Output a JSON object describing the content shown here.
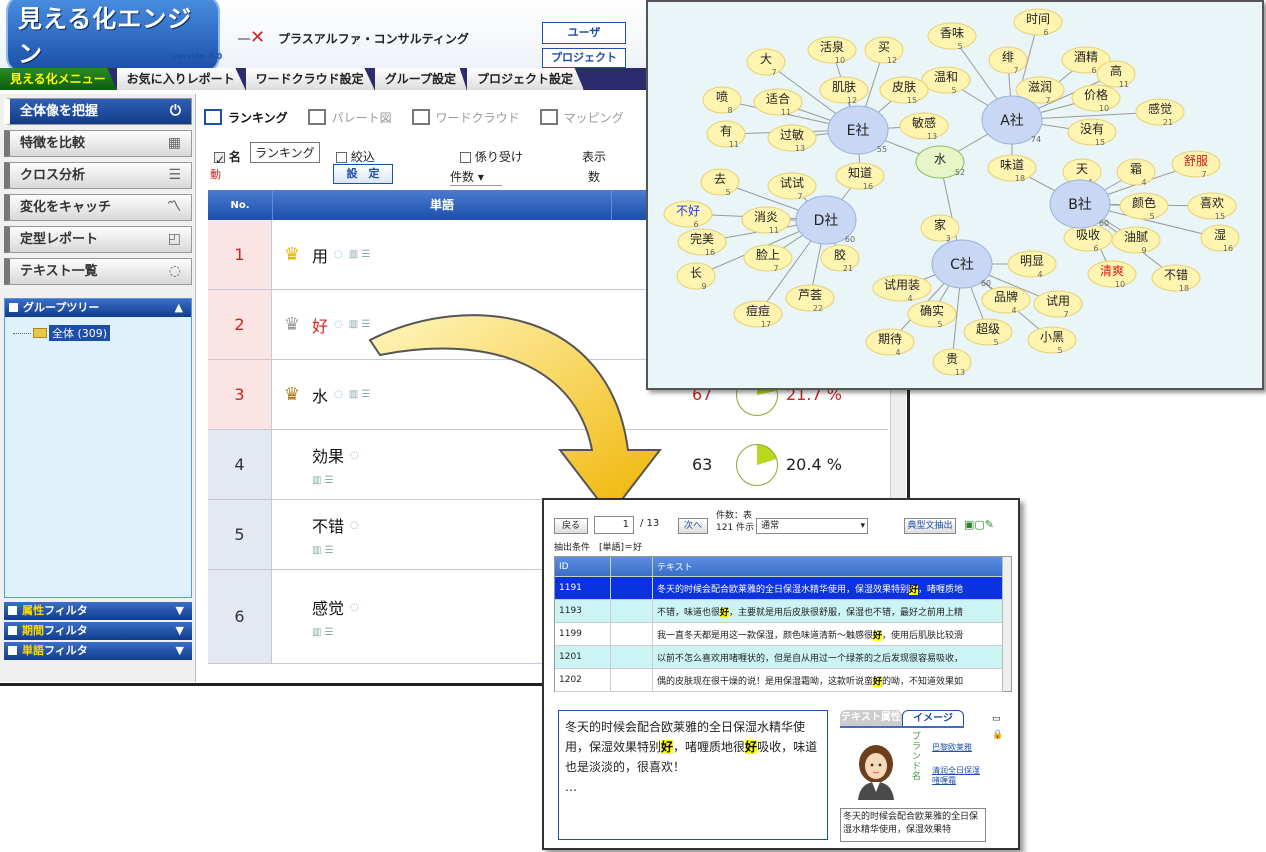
{
  "app": {
    "logo": "見える化エンジン",
    "version": "version 4.0",
    "company": "プラスアルファ・コンサルティング",
    "user_btn": "ユーザ",
    "project_btn": "プロジェクト"
  },
  "menu": {
    "tabs": [
      "見える化メニュー",
      "お気に入りレポート",
      "ワードクラウド設定",
      "グループ設定",
      "プロジェクト設定"
    ]
  },
  "sidebar": {
    "items": [
      {
        "label": "全体像を把握",
        "icon": "power-icon"
      },
      {
        "label": "特徴を比較",
        "icon": "compare-icon"
      },
      {
        "label": "クロス分析",
        "icon": "bars-icon"
      },
      {
        "label": "変化をキャッチ",
        "icon": "trend-icon"
      },
      {
        "label": "定型レポート",
        "icon": "report-icon"
      },
      {
        "label": "テキスト一覧",
        "icon": "speech-icon"
      }
    ],
    "group_tree": {
      "title": "グループツリー",
      "item": "全体 (309)"
    },
    "filters": [
      {
        "hl": "属性",
        "rest": "フィルタ"
      },
      {
        "hl": "期間",
        "rest": "フィルタ"
      },
      {
        "hl": "単語",
        "rest": "フィルタ"
      }
    ]
  },
  "view_tabs": [
    "ランキング",
    "パレート図",
    "ワードクラウド",
    "マッピング"
  ],
  "controls": {
    "name_check": "名",
    "tooltip": "ランキング",
    "move": "動",
    "narrow": "絞込",
    "dependency": "係り受け",
    "display": "表示",
    "count": "件数",
    "count_suffix": "数",
    "set_button": "設　定"
  },
  "table": {
    "headers": {
      "no": "No.",
      "word": "単語"
    },
    "rows": [
      {
        "no": "1",
        "word": "用",
        "crown": "gold",
        "count": "",
        "pct": ""
      },
      {
        "no": "2",
        "word": "好",
        "crown": "silver",
        "count": "",
        "pct": ""
      },
      {
        "no": "3",
        "word": "水",
        "crown": "bronze",
        "count": "67",
        "pct": "21.7 %",
        "share": 0.217
      },
      {
        "no": "4",
        "word": "効果",
        "crown": "",
        "count": "63",
        "pct": "20.4 %",
        "share": 0.204
      },
      {
        "no": "5",
        "word": "不错",
        "crown": "",
        "count": "",
        "pct": ""
      },
      {
        "no": "6",
        "word": "感觉",
        "crown": "",
        "count": "",
        "pct": ""
      }
    ]
  },
  "network": {
    "hubs": [
      {
        "label": "E社",
        "count": "55"
      },
      {
        "label": "A社",
        "count": "74"
      },
      {
        "label": "D社",
        "count": "60"
      },
      {
        "label": "B社",
        "count": "60"
      },
      {
        "label": "C社",
        "count": "60"
      }
    ],
    "words": [
      {
        "w": "大",
        "n": "7"
      },
      {
        "w": "活泉",
        "n": "10"
      },
      {
        "w": "买",
        "n": "12"
      },
      {
        "w": "香味",
        "n": "5"
      },
      {
        "w": "时间",
        "n": "6"
      },
      {
        "w": "绯",
        "n": "7"
      },
      {
        "w": "酒精",
        "n": "6"
      },
      {
        "w": "温和",
        "n": "5"
      },
      {
        "w": "滋润",
        "n": "7"
      },
      {
        "w": "高",
        "n": "11"
      },
      {
        "w": "价格",
        "n": "10"
      },
      {
        "w": "感觉",
        "n": "21"
      },
      {
        "w": "没有",
        "n": "15"
      },
      {
        "w": "喷",
        "n": "8"
      },
      {
        "w": "适合",
        "n": "11"
      },
      {
        "w": "肌肤",
        "n": "12"
      },
      {
        "w": "皮肤",
        "n": "15"
      },
      {
        "w": "有",
        "n": "11"
      },
      {
        "w": "过敏",
        "n": "13"
      },
      {
        "w": "敏感",
        "n": "13"
      },
      {
        "w": "水",
        "n": "52"
      },
      {
        "w": "味道",
        "n": "18"
      },
      {
        "w": "天",
        "n": "4"
      },
      {
        "w": "霜",
        "n": "4"
      },
      {
        "w": "舒服",
        "n": "7"
      },
      {
        "w": "去",
        "n": "5"
      },
      {
        "w": "试试",
        "n": "7"
      },
      {
        "w": "知道",
        "n": "16"
      },
      {
        "w": "颜色",
        "n": "5"
      },
      {
        "w": "喜欢",
        "n": "15"
      },
      {
        "w": "不好",
        "n": "6"
      },
      {
        "w": "消炎",
        "n": "11"
      },
      {
        "w": "吸收",
        "n": "6"
      },
      {
        "w": "油腻",
        "n": "9"
      },
      {
        "w": "湿",
        "n": "16"
      },
      {
        "w": "完美",
        "n": "16"
      },
      {
        "w": "家",
        "n": "3"
      },
      {
        "w": "脸上",
        "n": "7"
      },
      {
        "w": "胶",
        "n": "21"
      },
      {
        "w": "明显",
        "n": "4"
      },
      {
        "w": "清爽",
        "n": "10"
      },
      {
        "w": "不错",
        "n": "18"
      },
      {
        "w": "长",
        "n": "9"
      },
      {
        "w": "试用装",
        "n": "4"
      },
      {
        "w": "品牌",
        "n": "4"
      },
      {
        "w": "试用",
        "n": "7"
      },
      {
        "w": "痘痘",
        "n": "17"
      },
      {
        "w": "芦荟",
        "n": "22"
      },
      {
        "w": "确实",
        "n": "5"
      },
      {
        "w": "超级",
        "n": "5"
      },
      {
        "w": "小黑",
        "n": "5"
      },
      {
        "w": "期待",
        "n": "4"
      },
      {
        "w": "贵",
        "n": "13"
      }
    ]
  },
  "detail": {
    "back_btn": "戻る",
    "page": "1",
    "page_total": "/ 13",
    "next_btn": "次へ",
    "count_label": "件数：表",
    "count_value": "121 件示",
    "sort": "通常",
    "extract_btn": "典型文抽出",
    "condition_label": "抽出条件",
    "condition_value": "[単語]＝好",
    "grid_headers": {
      "id": "ID",
      "text": "テキスト"
    },
    "rows": [
      {
        "id": "1191",
        "pre": "冬天的时候会配合欧莱雅的全日保湿水精华使用，保湿效果特别",
        "kw": "好",
        "post": "，啫喱质地"
      },
      {
        "id": "1193",
        "pre": "不错，味道也很",
        "kw": "好",
        "post": "，主要就是用后皮肤很舒服，保湿也不错，最好之前用上精"
      },
      {
        "id": "1199",
        "pre": "我一直冬天都是用这一款保湿，颜色味道清新～触感很",
        "kw": "好",
        "post": "，使用后肌肤比较滑"
      },
      {
        "id": "1201",
        "pre": "以前不怎么喜欢用啫喱状的，但是自从用过一个绿茶的之后发现很容易吸收，",
        "kw": "",
        "post": ""
      },
      {
        "id": "1202",
        "pre": "偶的皮肤现在很干燥的说！是用保湿霜呦，这款听说蛮",
        "kw": "好",
        "post": "的呦，不知道效果如"
      }
    ],
    "text_p1": "冬天的时候会配合欧莱雅的全日保湿水精华使用，保湿效果特别",
    "text_kw1": "好",
    "text_p2": "，啫喱质地很",
    "text_kw2": "好",
    "text_p3": "吸收，味道也是淡淡的，很喜欢！",
    "text_more": "…",
    "tab_attr": "テキスト属性",
    "tab_image": "イメージ",
    "brand_label": "ブランド名",
    "brand_link1": "巴黎欧莱雅",
    "brand_link2": "清润全日保湿啫喱霜",
    "snippet": "冬天的时候会配合欧莱雅的全日保湿水精华使用，保湿效果特"
  }
}
